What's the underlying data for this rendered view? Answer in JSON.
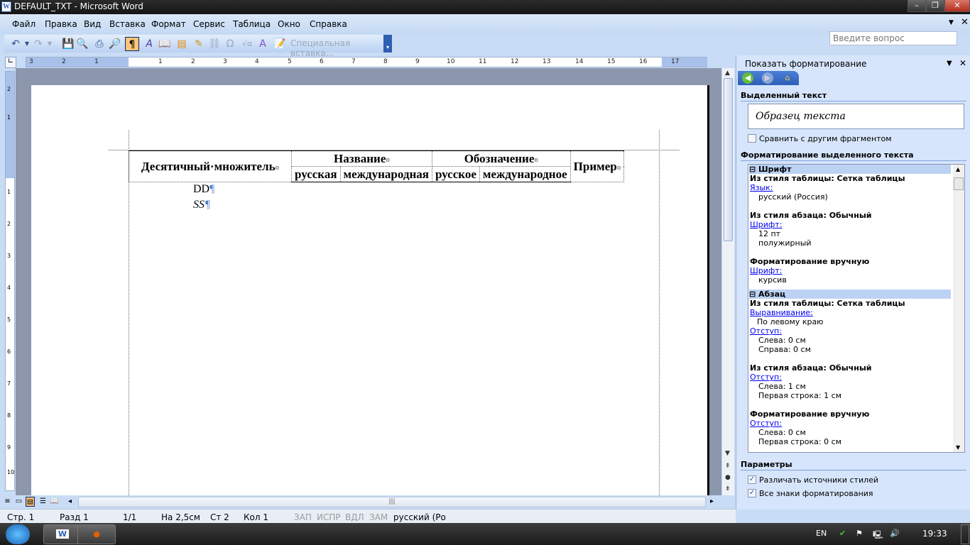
{
  "window": {
    "title": "DEFAULT_TXT - Microsoft Word",
    "app_icon": "W"
  },
  "menu": [
    {
      "label": "Файл"
    },
    {
      "label": "Правка"
    },
    {
      "label": "Вид"
    },
    {
      "label": "Вставка"
    },
    {
      "label": "Формат"
    },
    {
      "label": "Сервис"
    },
    {
      "label": "Таблица"
    },
    {
      "label": "Окно"
    },
    {
      "label": "Справка"
    }
  ],
  "help": {
    "placeholder": "Введите вопрос"
  },
  "toolbar": {
    "icons": [
      "undo-icon",
      "redo-icon",
      "save-icon",
      "print-preview-icon",
      "print-icon",
      "research-icon",
      "show-formatting-icon",
      "styles-icon",
      "book-icon",
      "document-icon",
      "format-painter-icon",
      "link-icon",
      "omega-icon",
      "formula-icon",
      "wordart-icon",
      "table-edit-icon"
    ],
    "paste_special": "Специальная вставка..."
  },
  "ruler": {
    "labels": [
      "3",
      "2",
      "1",
      "1",
      "2",
      "3",
      "4",
      "5",
      "6",
      "7",
      "8",
      "9",
      "10",
      "11",
      "12",
      "13",
      "14",
      "15",
      "16",
      "17"
    ]
  },
  "vruler": {
    "labels": [
      "2",
      "1",
      "1",
      "2",
      "3",
      "4",
      "5",
      "6",
      "7",
      "8",
      "9",
      "10"
    ]
  },
  "document": {
    "table": {
      "header1": "Десятичный·множитель",
      "mark": "¤",
      "name": "Название",
      "designation": "Обозначение",
      "example": "Пример",
      "sub": [
        "русская",
        "международная",
        "русское",
        "международное"
      ]
    },
    "paragraphs": [
      "DD",
      "SS"
    ],
    "pilcrow": "¶"
  },
  "status": {
    "page": "Стр. 1",
    "section": "Разд 1",
    "pages": "1/1",
    "at": "На 2,5см",
    "line": "Ст 2",
    "col": "Кол 1",
    "rec": "ЗАП",
    "trk": "ИСПР",
    "ext": "ВДЛ",
    "ovr": "ЗАМ",
    "lang": "русский (Ро"
  },
  "pane": {
    "title": "Показать форматирование",
    "selected_text_header": "Выделенный текст",
    "sample": "Образец текста",
    "compare_label": "Сравнить с другим фрагментом",
    "compare_checked": false,
    "formatting_header": "Форматирование выделенного текста",
    "lines": [
      {
        "t": "Шрифт",
        "k": "grp"
      },
      {
        "t": "Из стиля таблицы: Сетка таблицы",
        "k": "b"
      },
      {
        "t": "Язык:",
        "k": "lk"
      },
      {
        "t": "русский (Россия)",
        "k": "v"
      },
      {
        "t": "Из стиля абзаца: Обычный",
        "k": "b"
      },
      {
        "t": "Шрифт:",
        "k": "lk"
      },
      {
        "t": "12 пт",
        "k": "v"
      },
      {
        "t": "полужирный",
        "k": "v"
      },
      {
        "t": "Форматирование вручную",
        "k": "b"
      },
      {
        "t": "Шрифт:",
        "k": "lk"
      },
      {
        "t": "курсив",
        "k": "v"
      },
      {
        "t": "Абзац",
        "k": "grp"
      },
      {
        "t": "Из стиля таблицы: Сетка таблицы",
        "k": "b"
      },
      {
        "t": "Выравнивание:",
        "k": "lk"
      },
      {
        "t": "По левому краю",
        "k": "v2"
      },
      {
        "t": "Отступ:",
        "k": "lk"
      },
      {
        "t": "Слева:  0 см",
        "k": "v"
      },
      {
        "t": "Справа:  0 см",
        "k": "v"
      },
      {
        "t": "Из стиля абзаца: Обычный",
        "k": "b"
      },
      {
        "t": "Отступ:",
        "k": "lk"
      },
      {
        "t": "Слева:  1 см",
        "k": "v"
      },
      {
        "t": "Первая строка:  1 см",
        "k": "v"
      },
      {
        "t": "Форматирование вручную",
        "k": "b"
      },
      {
        "t": "Отступ:",
        "k": "lk"
      },
      {
        "t": "Слева:  0 см",
        "k": "v"
      },
      {
        "t": "Первая строка:  0 см",
        "k": "v"
      }
    ],
    "params_header": "Параметры",
    "opt1": "Различать источники стилей",
    "opt1_checked": true,
    "opt2": "Все знаки форматирования",
    "opt2_checked": true
  },
  "taskbar": {
    "lang": "EN",
    "time": "19:33"
  }
}
